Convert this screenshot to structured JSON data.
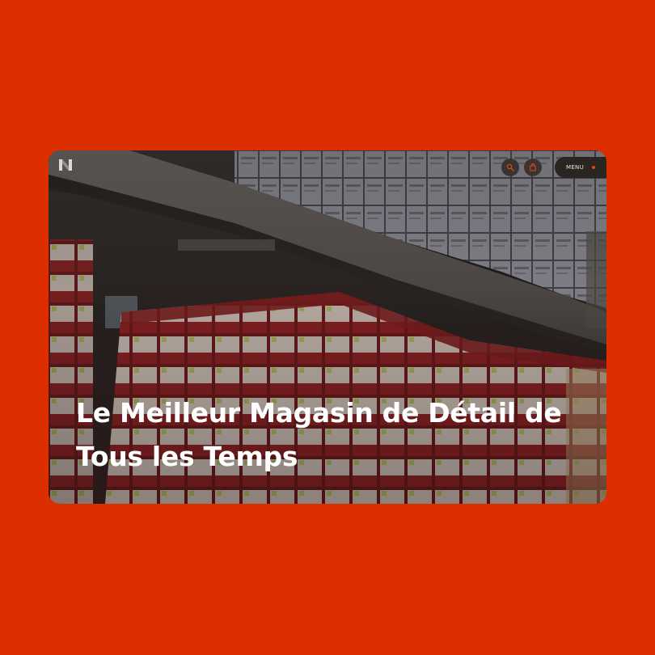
{
  "hero": {
    "headline": "Le Meilleur Magasin de Détail de Tous les Temps",
    "background_image": "warehouse-shelves-with-red-and-white-boxes"
  },
  "header": {
    "logo": "N",
    "search_icon": "search-icon",
    "cart_icon": "shopping-bag-icon",
    "menu_label": "MENU"
  },
  "colors": {
    "page_background": "#dd2e00",
    "accent": "#e0431a",
    "header_pill": "#2b2522",
    "headline_text": "#ffffff"
  }
}
